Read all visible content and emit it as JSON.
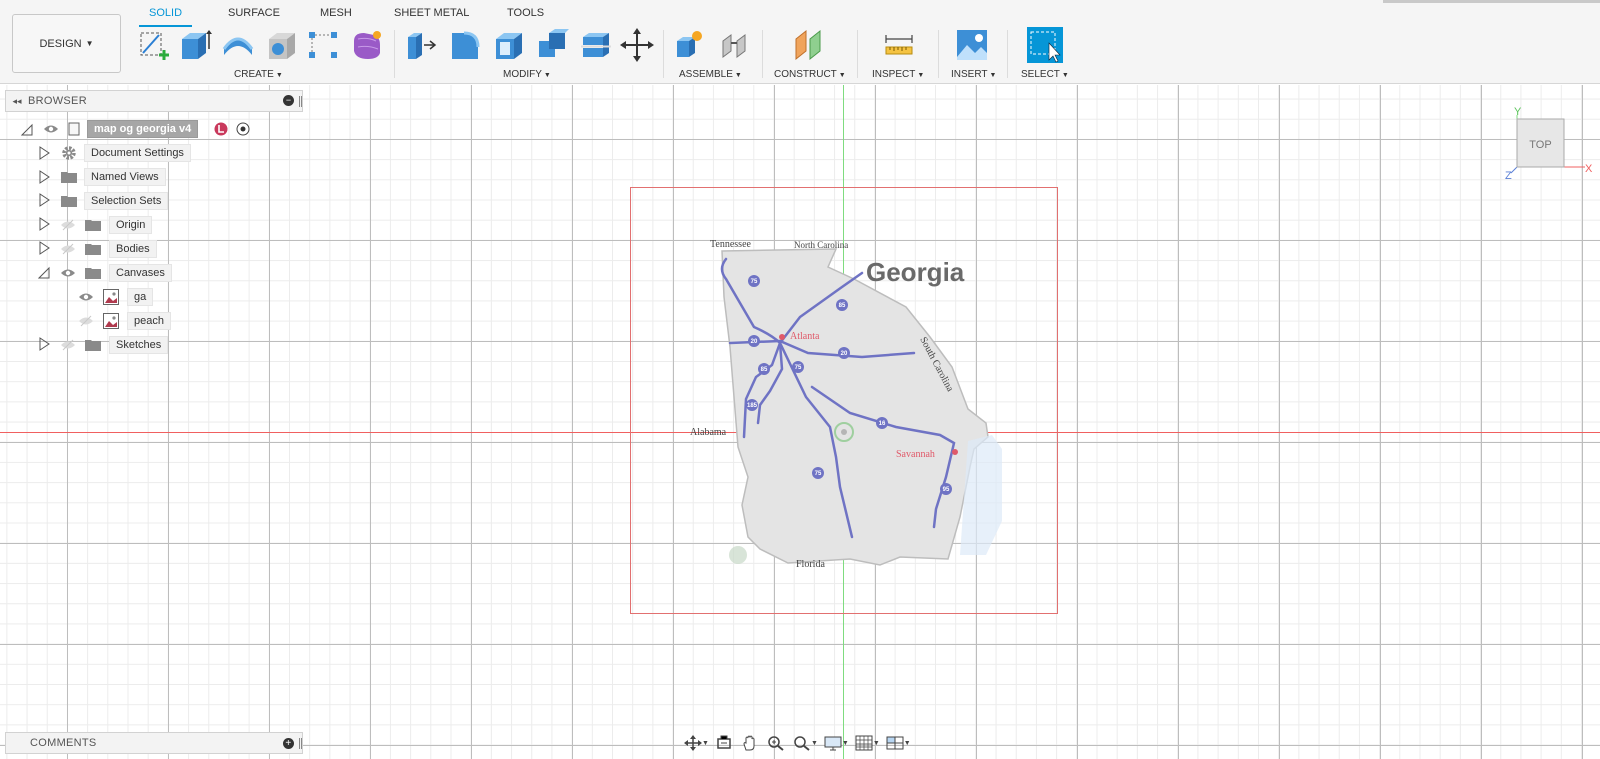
{
  "toolbar": {
    "workspace": "DESIGN",
    "tabs": [
      "SOLID",
      "SURFACE",
      "MESH",
      "SHEET METAL",
      "TOOLS"
    ],
    "active_tab": "SOLID",
    "groups": [
      "CREATE",
      "MODIFY",
      "ASSEMBLE",
      "CONSTRUCT",
      "INSPECT",
      "INSERT",
      "SELECT"
    ]
  },
  "browser": {
    "title": "BROWSER",
    "root": "map og georgia v4",
    "items": [
      "Document Settings",
      "Named Views",
      "Selection Sets",
      "Origin",
      "Bodies",
      "Canvases",
      "ga",
      "peach",
      "Sketches"
    ]
  },
  "comments": {
    "title": "COMMENTS"
  },
  "viewcube": {
    "face": "TOP",
    "x": "X",
    "y": "Y",
    "z": "Z"
  },
  "map": {
    "title": "Georgia",
    "states": [
      "Tennessee",
      "North Carolina",
      "South Carolina",
      "Alabama",
      "Florida"
    ],
    "cities": [
      "Atlanta",
      "Savannah"
    ],
    "highways": [
      "75",
      "85",
      "20",
      "85",
      "75",
      "185",
      "16",
      "75",
      "95",
      "20"
    ]
  },
  "colors": {
    "accent": "#0696d7",
    "x_axis": "#f06060",
    "y_axis": "#7fdc7f",
    "sketch": "#e27070",
    "roads": "#6f73c4",
    "cities": "#e05a6a"
  }
}
